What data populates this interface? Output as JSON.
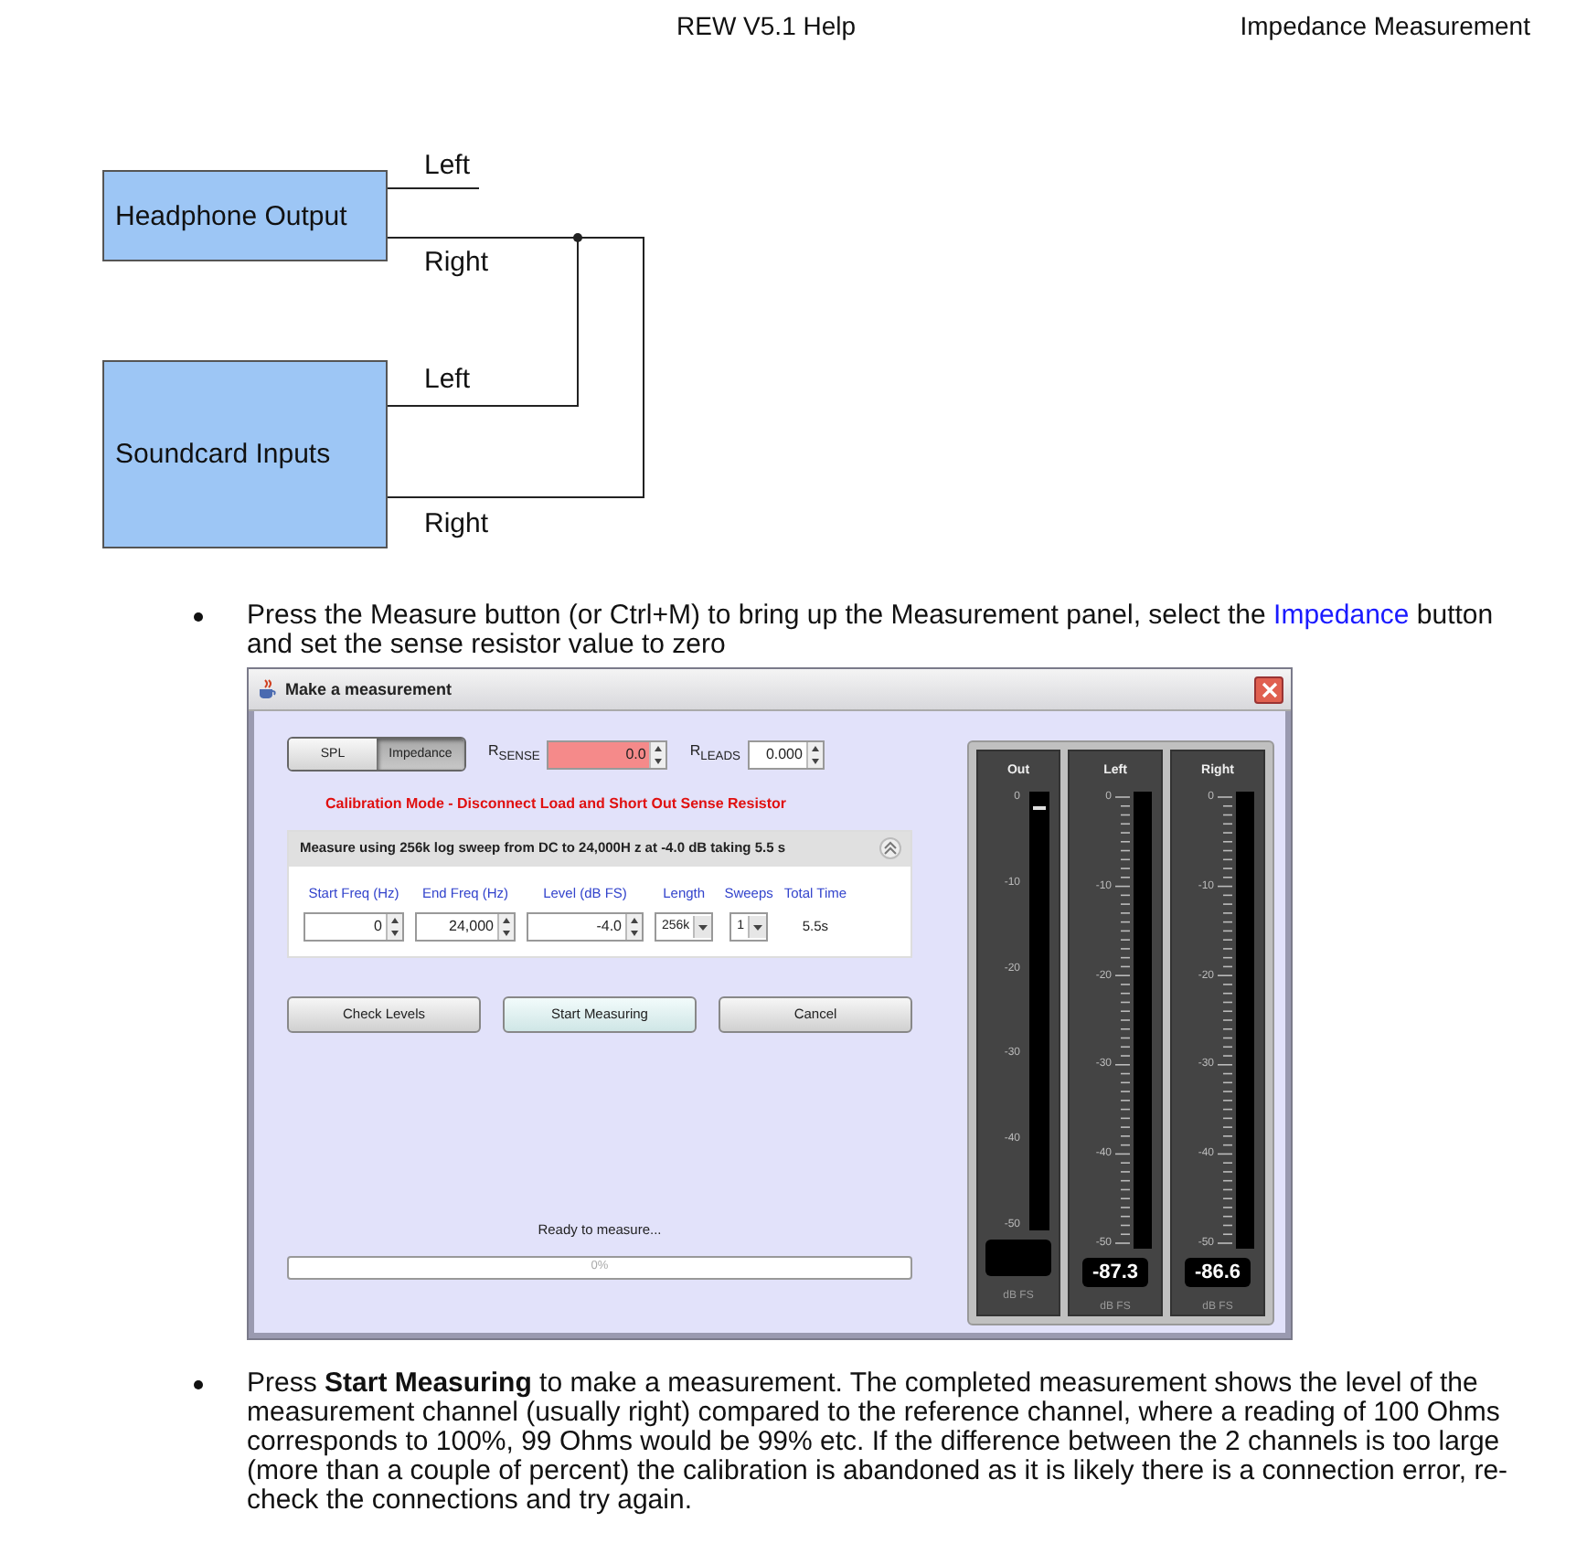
{
  "header": {
    "title": "REW V5.1 Help",
    "section": "Impedance Measurement"
  },
  "diagram": {
    "sources": [
      {
        "label": "Headphone Output",
        "channels": [
          "Left",
          "Right"
        ]
      },
      {
        "label": "Soundcard Inputs",
        "channels": [
          "Left",
          "Right"
        ]
      }
    ]
  },
  "steps": [
    {
      "kind": "link",
      "before": "Press the Measure button (or Ctrl+M) to bring up the Measurement panel, select the ",
      "link": "Impedance",
      "after": " button and set the sense resistor value to zero"
    },
    {
      "kind": "plain",
      "text": "Press **Start Measuring** to make a measurement. The completed measurement shows the level of the measurement channel (usually right) compared to the reference channel, where a reading of 100 Ohms corresponds to 100%, 99 Ohms would be 99% etc. If the difference between the 2 channels is too large (more than a couple of percent) the calibration is abandoned as it is likely there is a connection error, re-check the connections and try again."
    }
  ],
  "dialog": {
    "title": "Make a measurement",
    "modes": [
      {
        "label": "SPL",
        "selected": false
      },
      {
        "label": "Impedance",
        "selected": true
      }
    ],
    "resistors": [
      {
        "label": "R$_{SENSE}$",
        "value": "0.0",
        "invalid": true
      },
      {
        "label": "R$_{LEADS}$",
        "value": "0.000",
        "invalid": false
      }
    ],
    "warning": "Calibration Mode - Disconnect Load and Short Out Sense Resistor",
    "sweep": {
      "summary": "Measure using  256k log sweep from DC to 24,000H z at -4.0 dB taking 5.5 s",
      "expanded": true,
      "fields": [
        {
          "kind": "spinner",
          "label": "Start Freq (Hz)",
          "value": "0"
        },
        {
          "kind": "spinner",
          "label": "End Freq (Hz)",
          "value": "24,000"
        },
        {
          "kind": "spinner",
          "label": "Level (dB FS)",
          "value": "-4.0"
        },
        {
          "kind": "dropdown",
          "label": "Length",
          "value": "256k"
        },
        {
          "kind": "dropdown",
          "label": "Sweeps",
          "value": "1"
        },
        {
          "kind": "readout",
          "label": "Total Time",
          "value": "5.5s"
        }
      ]
    },
    "buttons": [
      {
        "label": "Check Levels",
        "selected": false
      },
      {
        "label": "Start Measuring",
        "selected": true
      },
      {
        "label": "Cancel",
        "selected": false
      }
    ],
    "status": "Ready to measure...",
    "progress": {
      "level": 0,
      "label": "0%"
    },
    "meters": [
      {
        "name": "Out",
        "kind": "plain",
        "ticks": [
          "0",
          "-10",
          "-20",
          "-30",
          "-40",
          "-50"
        ],
        "level": 0.96,
        "unit": "dB FS"
      },
      {
        "name": "Left",
        "kind": "scaled",
        "ticks": [
          "0",
          "-10",
          "-20",
          "-30",
          "-40",
          "-50"
        ],
        "reading": "-87.3",
        "unit": "dB FS"
      },
      {
        "name": "Right",
        "kind": "scaled",
        "ticks": [
          "0",
          "-10",
          "-20",
          "-30",
          "-40",
          "-50"
        ],
        "reading": "-86.6",
        "unit": "dB FS"
      }
    ]
  }
}
